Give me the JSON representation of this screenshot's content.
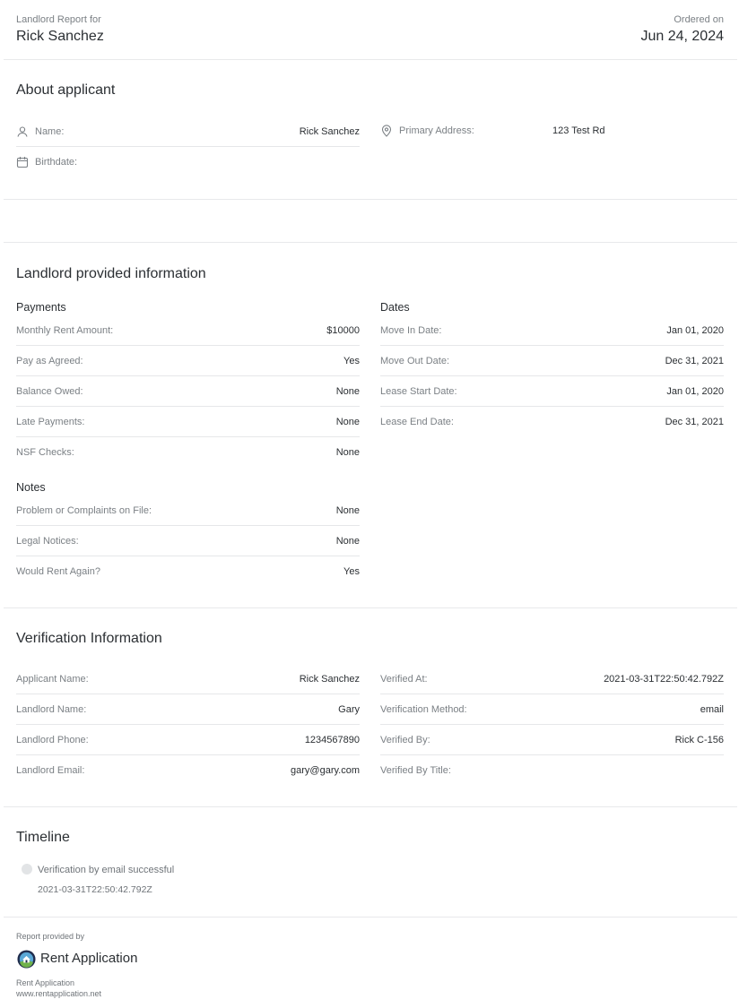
{
  "header": {
    "report_label": "Landlord Report for",
    "applicant_name": "Rick Sanchez",
    "ordered_label": "Ordered on",
    "ordered_date": "Jun 24, 2024"
  },
  "about": {
    "title": "About applicant",
    "name_label": "Name:",
    "name_value": "Rick Sanchez",
    "birthdate_label": "Birthdate:",
    "birthdate_value": "",
    "address_label": "Primary Address:",
    "address_value": "123 Test Rd"
  },
  "landlord": {
    "title": "Landlord provided information",
    "payments_title": "Payments",
    "payments": [
      {
        "label": "Monthly Rent Amount:",
        "value": "$10000"
      },
      {
        "label": "Pay as Agreed:",
        "value": "Yes"
      },
      {
        "label": "Balance Owed:",
        "value": "None"
      },
      {
        "label": "Late Payments:",
        "value": "None"
      },
      {
        "label": "NSF Checks:",
        "value": "None"
      }
    ],
    "dates_title": "Dates",
    "dates": [
      {
        "label": "Move In Date:",
        "value": "Jan 01, 2020"
      },
      {
        "label": "Move Out Date:",
        "value": "Dec 31, 2021"
      },
      {
        "label": "Lease Start Date:",
        "value": "Jan 01, 2020"
      },
      {
        "label": "Lease End Date:",
        "value": "Dec 31, 2021"
      }
    ],
    "notes_title": "Notes",
    "notes": [
      {
        "label": "Problem or Complaints on File:",
        "value": "None"
      },
      {
        "label": "Legal Notices:",
        "value": "None"
      },
      {
        "label": "Would Rent Again?",
        "value": "Yes"
      }
    ]
  },
  "verification": {
    "title": "Verification Information",
    "left": [
      {
        "label": "Applicant Name:",
        "value": "Rick Sanchez"
      },
      {
        "label": "Landlord Name:",
        "value": "Gary"
      },
      {
        "label": "Landlord Phone:",
        "value": "1234567890"
      },
      {
        "label": "Landlord Email:",
        "value": "gary@gary.com"
      }
    ],
    "right": [
      {
        "label": "Verified At:",
        "value": "2021-03-31T22:50:42.792Z"
      },
      {
        "label": "Verification Method:",
        "value": "email"
      },
      {
        "label": "Verified By:",
        "value": "Rick C-156"
      },
      {
        "label": "Verified By Title:",
        "value": ""
      }
    ]
  },
  "timeline": {
    "title": "Timeline",
    "events": [
      {
        "text": "Verification by email successful",
        "time": "2021-03-31T22:50:42.792Z"
      }
    ]
  },
  "footer": {
    "provided_by": "Report provided by",
    "brand": "Rent Application",
    "company": "Rent Application",
    "website": "www.rentapplication.net"
  },
  "icons": {
    "name": "person-icon",
    "birthdate": "calendar-icon",
    "address": "location-pin-icon",
    "logo": "house-logo-icon"
  },
  "colors": {
    "logo_ring": "#1f2c4d",
    "logo_sky": "#5aa7d6",
    "logo_ground": "#6fb24a"
  }
}
